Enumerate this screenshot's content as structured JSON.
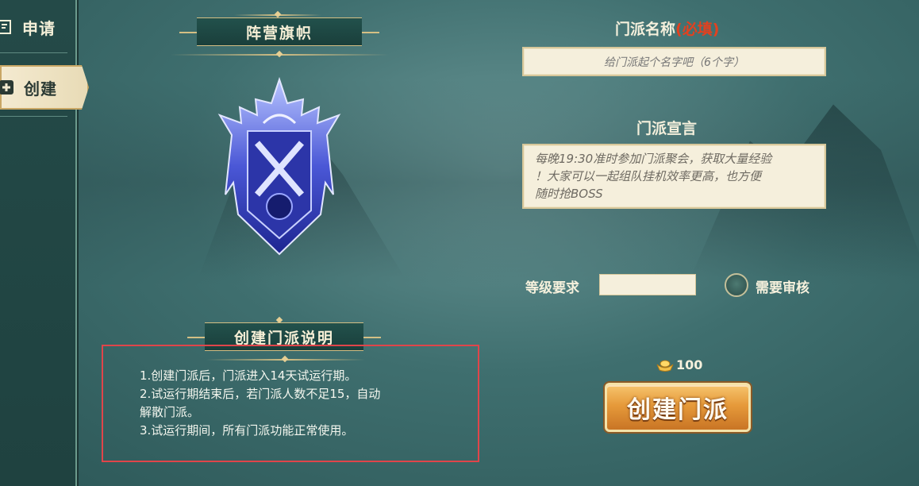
{
  "sidebar": {
    "items": [
      {
        "label": "申请",
        "icon": "apply-icon",
        "active": false
      },
      {
        "label": "创建",
        "icon": "create-plus-icon",
        "active": true
      }
    ]
  },
  "banner": {
    "title": "阵营旗帜",
    "emblem_icon": "blue-faction-emblem-icon"
  },
  "instructions": {
    "title": "创建门派说明",
    "lines": [
      "1.创建门派后，门派进入14天试运行期。",
      "2.试运行期结束后，若门派人数不足15，自动",
      "解散门派。",
      "3.试运行期间，所有门派功能正常使用。"
    ]
  },
  "form": {
    "name_label": "门派名称",
    "name_required": "(必填)",
    "name_placeholder": "给门派起个名字吧（6个字）",
    "declaration_label": "门派宣言",
    "declaration_lines": [
      "每晚19:30准时参加门派聚会，获取大量经验",
      "！大家可以一起组队挂机效率更高，也方便",
      "随时抢BOSS"
    ],
    "level_label": "等级要求",
    "level_value": "",
    "review_label": "需要审核",
    "review_checked": false
  },
  "cost": {
    "amount": "100",
    "icon": "gold-ingot-icon"
  },
  "create_button": {
    "label": "创建门派"
  },
  "colors": {
    "required_red": "#e2411f",
    "highlight_border": "#e0454a",
    "button_orange": "#e69a3a"
  }
}
